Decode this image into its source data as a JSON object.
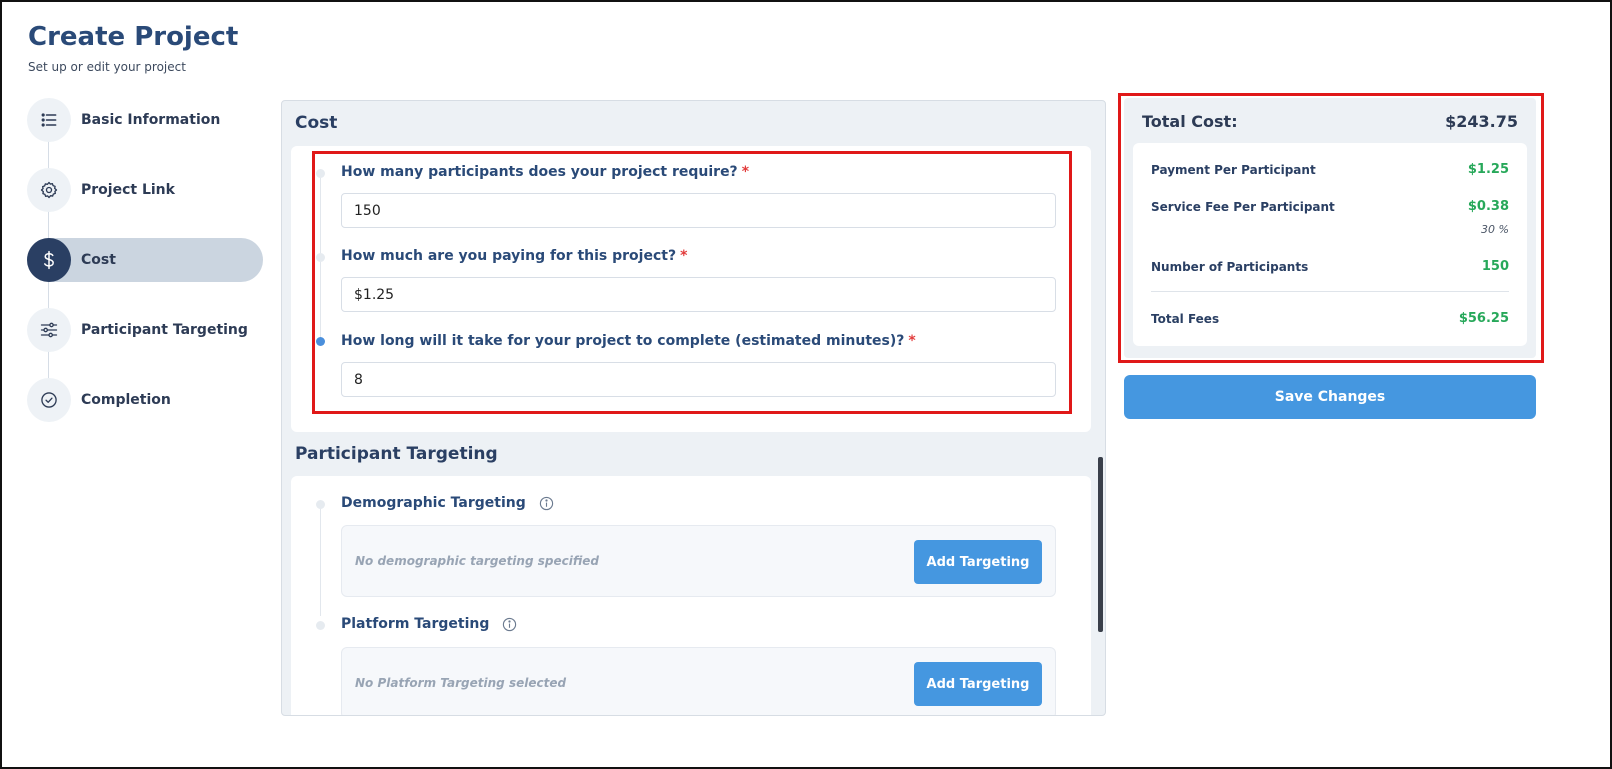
{
  "header": {
    "title": "Create Project",
    "subtitle": "Set up or edit your project"
  },
  "steps": [
    {
      "label": "Basic Information",
      "icon": "list-icon"
    },
    {
      "label": "Project Link",
      "icon": "gear-icon"
    },
    {
      "label": "Cost",
      "icon": "dollar-icon",
      "active": true
    },
    {
      "label": "Participant Targeting",
      "icon": "sliders-icon"
    },
    {
      "label": "Completion",
      "icon": "check-circle-icon"
    }
  ],
  "cost": {
    "title": "Cost",
    "questions": [
      {
        "label": "How many participants does your project require?",
        "required_mark": "*",
        "value": "150"
      },
      {
        "label": "How much are you paying for this project?",
        "required_mark": "*",
        "value": "$1.25"
      },
      {
        "label": "How long will it take for your project to complete (estimated minutes)?",
        "required_mark": "*",
        "value": "8"
      }
    ]
  },
  "targeting": {
    "title": "Participant Targeting",
    "demographic": {
      "label": "Demographic Targeting",
      "empty_text": "No demographic targeting specified",
      "button_label": "Add Targeting"
    },
    "platform": {
      "label": "Platform Targeting",
      "empty_text": "No Platform Targeting selected",
      "button_label": "Add Targeting"
    }
  },
  "summary": {
    "title": "Total Cost:",
    "total": "$243.75",
    "payment_label": "Payment Per Participant",
    "payment_value": "$1.25",
    "fee_label": "Service Fee Per Participant",
    "fee_value": "$0.38",
    "fee_percent": "30 %",
    "participants_label": "Number of Participants",
    "participants_value": "150",
    "total_fees_label": "Total Fees",
    "total_fees_value": "$56.25"
  },
  "save_label": "Save Changes",
  "colors": {
    "accent": "#4597e0",
    "navy": "#2a3f63",
    "green": "#27a85a",
    "highlight": "#e01818"
  }
}
